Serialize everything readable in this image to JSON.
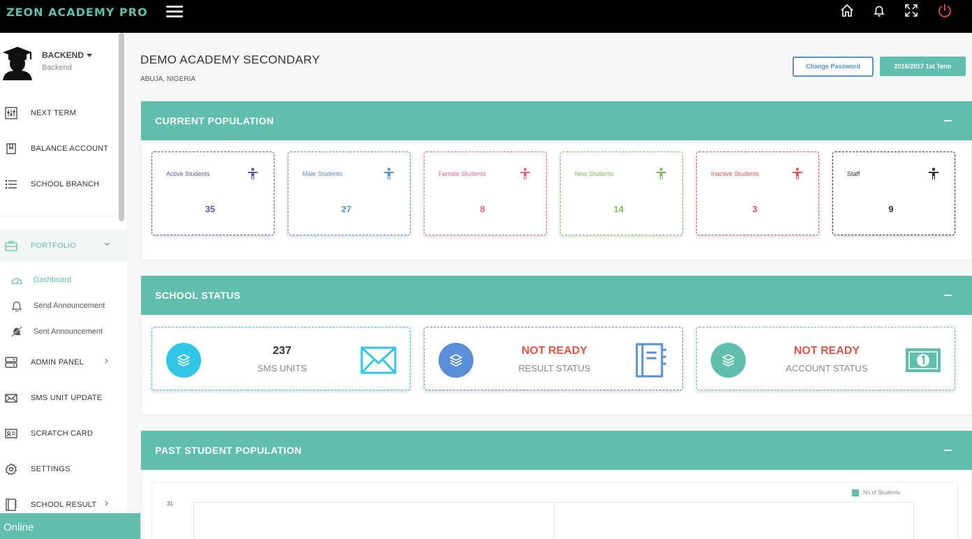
{
  "app": {
    "brand": "ZEON ACADEMY PRO"
  },
  "topbar": {
    "icons": [
      "home-icon",
      "bell-icon",
      "fullscreen-icon",
      "power-icon"
    ]
  },
  "profile": {
    "name": "BACKEND",
    "role": "Backend"
  },
  "sidebar": {
    "items": [
      {
        "label": "NEXT TERM",
        "icon": "sliders-icon"
      },
      {
        "label": "BALANCE ACCOUNT",
        "icon": "bookmark-icon"
      },
      {
        "label": "SCHOOL BRANCH",
        "icon": "list-icon"
      },
      {
        "label": "PORTFOLIO",
        "icon": "briefcase-icon"
      },
      {
        "label": "ADMIN PANEL",
        "icon": "server-icon"
      },
      {
        "label": "SMS UNIT UPDATE",
        "icon": "envelope-icon"
      },
      {
        "label": "SCRATCH CARD",
        "icon": "id-card-icon"
      },
      {
        "label": "SETTINGS",
        "icon": "gear-icon"
      },
      {
        "label": "SCHOOL RESULT",
        "icon": "notebook-icon"
      }
    ],
    "portfolio_sub": [
      {
        "label": "Dashboard",
        "icon": "dashboard-icon"
      },
      {
        "label": "Send Announcement",
        "icon": "bell-icon"
      },
      {
        "label": "Sent Announcement",
        "icon": "bell-off-icon"
      }
    ],
    "online": "Online"
  },
  "header": {
    "school_name": "DEMO ACADEMY SECONDARY",
    "location": "ABUJA, NIGERIA",
    "change_password": "Change Password",
    "term": "2016/2017 1st Term"
  },
  "population": {
    "title": "CURRENT POPULATION",
    "cards": [
      {
        "label": "Active Students",
        "value": "35",
        "color": "#6655a5"
      },
      {
        "label": "Male Students",
        "value": "27",
        "color": "#5a8ed6"
      },
      {
        "label": "Female Students",
        "value": "8",
        "color": "#e8648a"
      },
      {
        "label": "New Students",
        "value": "14",
        "color": "#7cbd55"
      },
      {
        "label": "Inactive Students",
        "value": "3",
        "color": "#e0534b"
      },
      {
        "label": "Staff",
        "value": "9",
        "color": "#333333"
      }
    ]
  },
  "status": {
    "title": "SCHOOL STATUS",
    "cards": [
      {
        "value": "237",
        "label": "SMS UNITS",
        "value_color": "#333333",
        "circle_color": "#31c5e6",
        "border_color": "#31c5e6",
        "icon": "envelope-icon"
      },
      {
        "value": "NOT READY",
        "label": "RESULT STATUS",
        "value_color": "#e0534b",
        "circle_color": "#5a8ed6",
        "border_color": "#5a8ed6",
        "icon": "notebook-icon"
      },
      {
        "value": "NOT READY",
        "label": "ACCOUNT STATUS",
        "value_color": "#e0534b",
        "circle_color": "#5fbfac",
        "border_color": "#5fbfac",
        "icon": "money-icon"
      }
    ]
  },
  "past": {
    "title": "PAST STUDENT POPULATION",
    "legend": "No of Students",
    "y_top": "31"
  }
}
